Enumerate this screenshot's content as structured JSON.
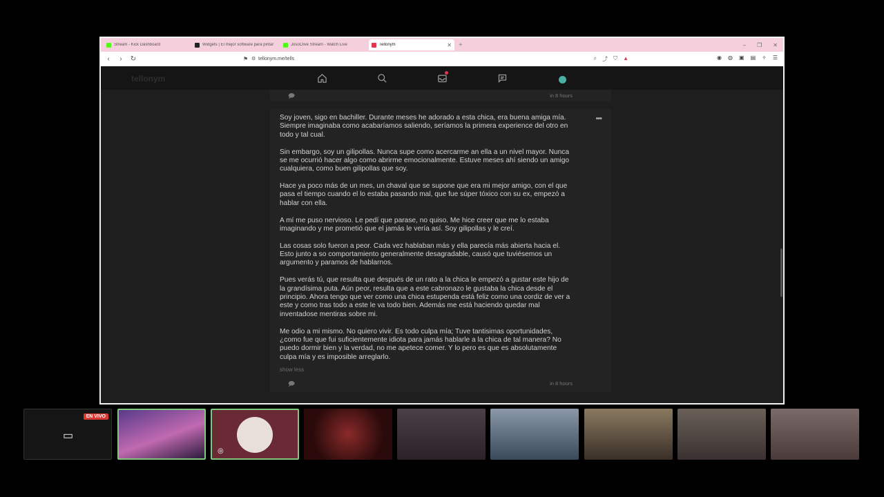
{
  "browser": {
    "tabs": [
      {
        "title": "Stream - Kick Dashboard",
        "color": "#53fc18"
      },
      {
        "title": "Widgets | El mejor software para pintar",
        "color": "#222222"
      },
      {
        "title": "JosoClive Stream - Watch Live",
        "color": "#53fc18"
      },
      {
        "title": "Tellonym",
        "color": "#e0364f",
        "active": true
      }
    ],
    "url": "tellonym.me/tells"
  },
  "site": {
    "logo": "tellonym",
    "nav": [
      "home-icon",
      "search-icon",
      "inbox-icon",
      "feed-icon",
      "avatar"
    ]
  },
  "feed": {
    "prev_time": "in 8 hours",
    "post": {
      "paragraphs": [
        "Soy joven, sigo en bachiller. Durante meses he adorado a esta chica, era buena amiga mía. Siempre imaginaba como acabaríamos saliendo, seríamos la primera experience del otro en todo y tal cual.",
        "Sin embargo, soy un gilipollas. Nunca supe como acercarme an ella a un nivel mayor. Nunca se me ocurrió hacer algo como abrirme emocionalmente. Estuve meses ahí siendo un amigo cualquiera, como buen gilipollas que soy.",
        "Hace ya poco más de un mes, un chaval que se supone que era mi mejor amigo, con el que pasa el tiempo cuando el lo estaba pasando mal, que fue súper tóxico con su ex, empezó a hablar con ella.",
        "A mí me puso nervioso. Le pedí que parase, no quiso. Me hice creer que me lo estaba imaginando y me prometió que el jamás le vería así. Soy gilipollas y le creí.",
        "Las cosas solo fueron a peor. Cada vez hablaban más y ella parecía más abierta hacia el. Esto junto a so comportamiento generalmente desagradable, causó que tuviésemos un argumento y paramos de hablarnos.",
        "Pues verás tú, que resulta que después de un rato a la chica le empezó a gustar este hijo de la grandísima puta. Aún peor, resulta que a este cabronazo le gustaba la chica desde el principio. Ahora tengo que ver como una chica estupenda está feliz como una cordiz de ver a este y como tras todo a este le va todo bien. Además me está haciendo quedar mal inventadose mentiras sobre mi.",
        "Me odio a mi mismo. No quiero vivir. Es todo culpa mía; Tuve tantisimas oportunidades, ¿como fue que fui suficientemente idiota para jamás hablarle a la chica de tal manera? No puedo dormir bien y la verdad, no me apetece comer. Y lo pero es que es absolutamente culpa mía y es imposible arreglarlo."
      ],
      "show_less": "show less",
      "time": "in 8 hours"
    }
  },
  "stream": {
    "live_badge": "EN VIVO",
    "cams": [
      {
        "name": "screen-share",
        "color": "#1a1a1a"
      },
      {
        "name": "cam-streamer-pink",
        "color": "#5a3a8a",
        "selected": true
      },
      {
        "name": "cam-logo-avatar",
        "color": "#6a2a35",
        "selected": true
      },
      {
        "name": "cam-anime-avatar",
        "color": "#3a1010"
      },
      {
        "name": "cam-glasses",
        "color": "#3a3036"
      },
      {
        "name": "cam-headset",
        "color": "#4a5a6a"
      },
      {
        "name": "cam-room",
        "color": "#5a5040"
      },
      {
        "name": "cam-headphones",
        "color": "#4a4040"
      },
      {
        "name": "cam-redhair",
        "color": "#6a5a5a"
      }
    ]
  }
}
